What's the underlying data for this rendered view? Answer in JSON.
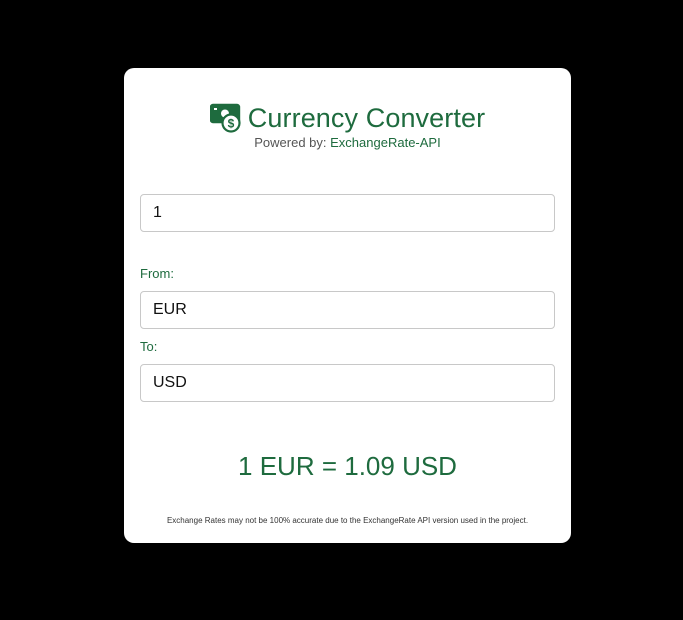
{
  "app": {
    "title": "Currency Converter",
    "logo_icon": "money-exchange-icon",
    "powered_prefix": "Powered by: ",
    "powered_link": "ExchangeRate-API"
  },
  "form": {
    "amount_value": "1",
    "from_label": "From:",
    "from_value": "EUR",
    "to_label": "To:",
    "to_value": "USD"
  },
  "result": {
    "text": "1 EUR = 1.09 USD"
  },
  "footer": {
    "disclaimer": "Exchange Rates may not be 100% accurate due to the ExchangeRate API version used in the project."
  },
  "colors": {
    "accent": "#1e6b3e",
    "background": "#000000",
    "card": "#ffffff"
  }
}
